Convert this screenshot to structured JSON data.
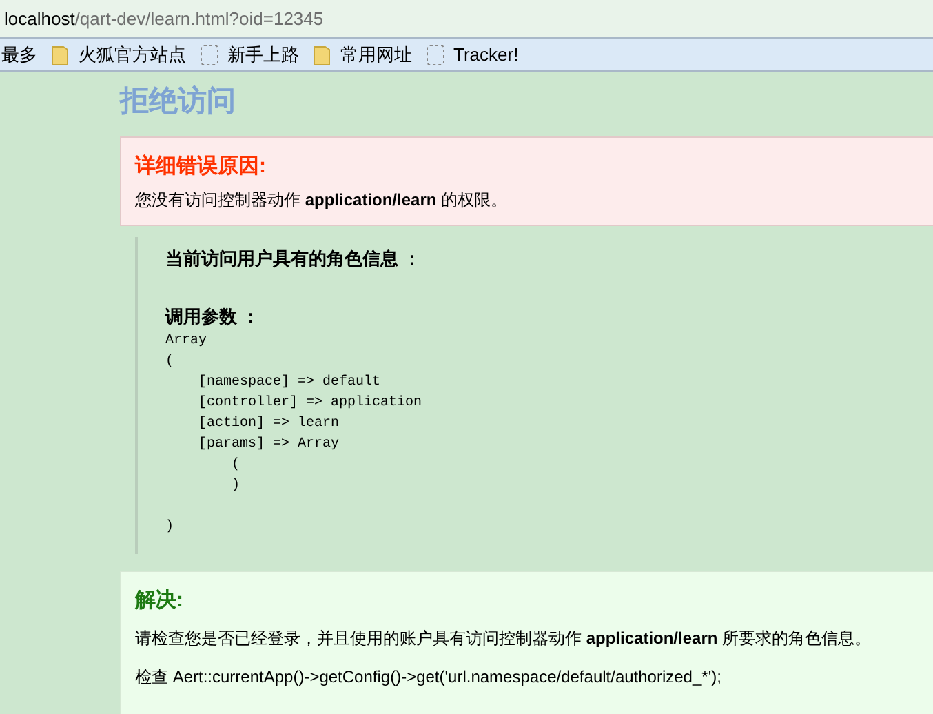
{
  "address_bar": {
    "host": "localhost",
    "path": "/qart-dev/learn.html?oid=12345"
  },
  "bookmarks": [
    {
      "kind": "label",
      "label": "最多"
    },
    {
      "kind": "folder",
      "label": "火狐官方站点"
    },
    {
      "kind": "page",
      "label": "新手上路"
    },
    {
      "kind": "folder",
      "label": "常用网址"
    },
    {
      "kind": "page",
      "label": "Tracker!"
    }
  ],
  "title": "拒绝访问",
  "error": {
    "heading": "详细错误原因:",
    "message": "您没有访问控制器动作 **application/learn** 的权限。"
  },
  "roles": {
    "heading": "当前访问用户具有的角色信息 ："
  },
  "params": {
    "heading": "调用参数 ：",
    "dump": "Array\n(\n    [namespace] => default\n    [controller] => application\n    [action] => learn\n    [params] => Array\n        (\n        )\n\n)"
  },
  "solution": {
    "heading": "解决:",
    "message": "请检查您是否已经登录，并且使用的账户具有访问控制器动作 **application/learn** 所要求的角色信息。",
    "hint": "检查 Aert::currentApp()->getConfig()->get('url.namespace/default/authorized_*');"
  }
}
